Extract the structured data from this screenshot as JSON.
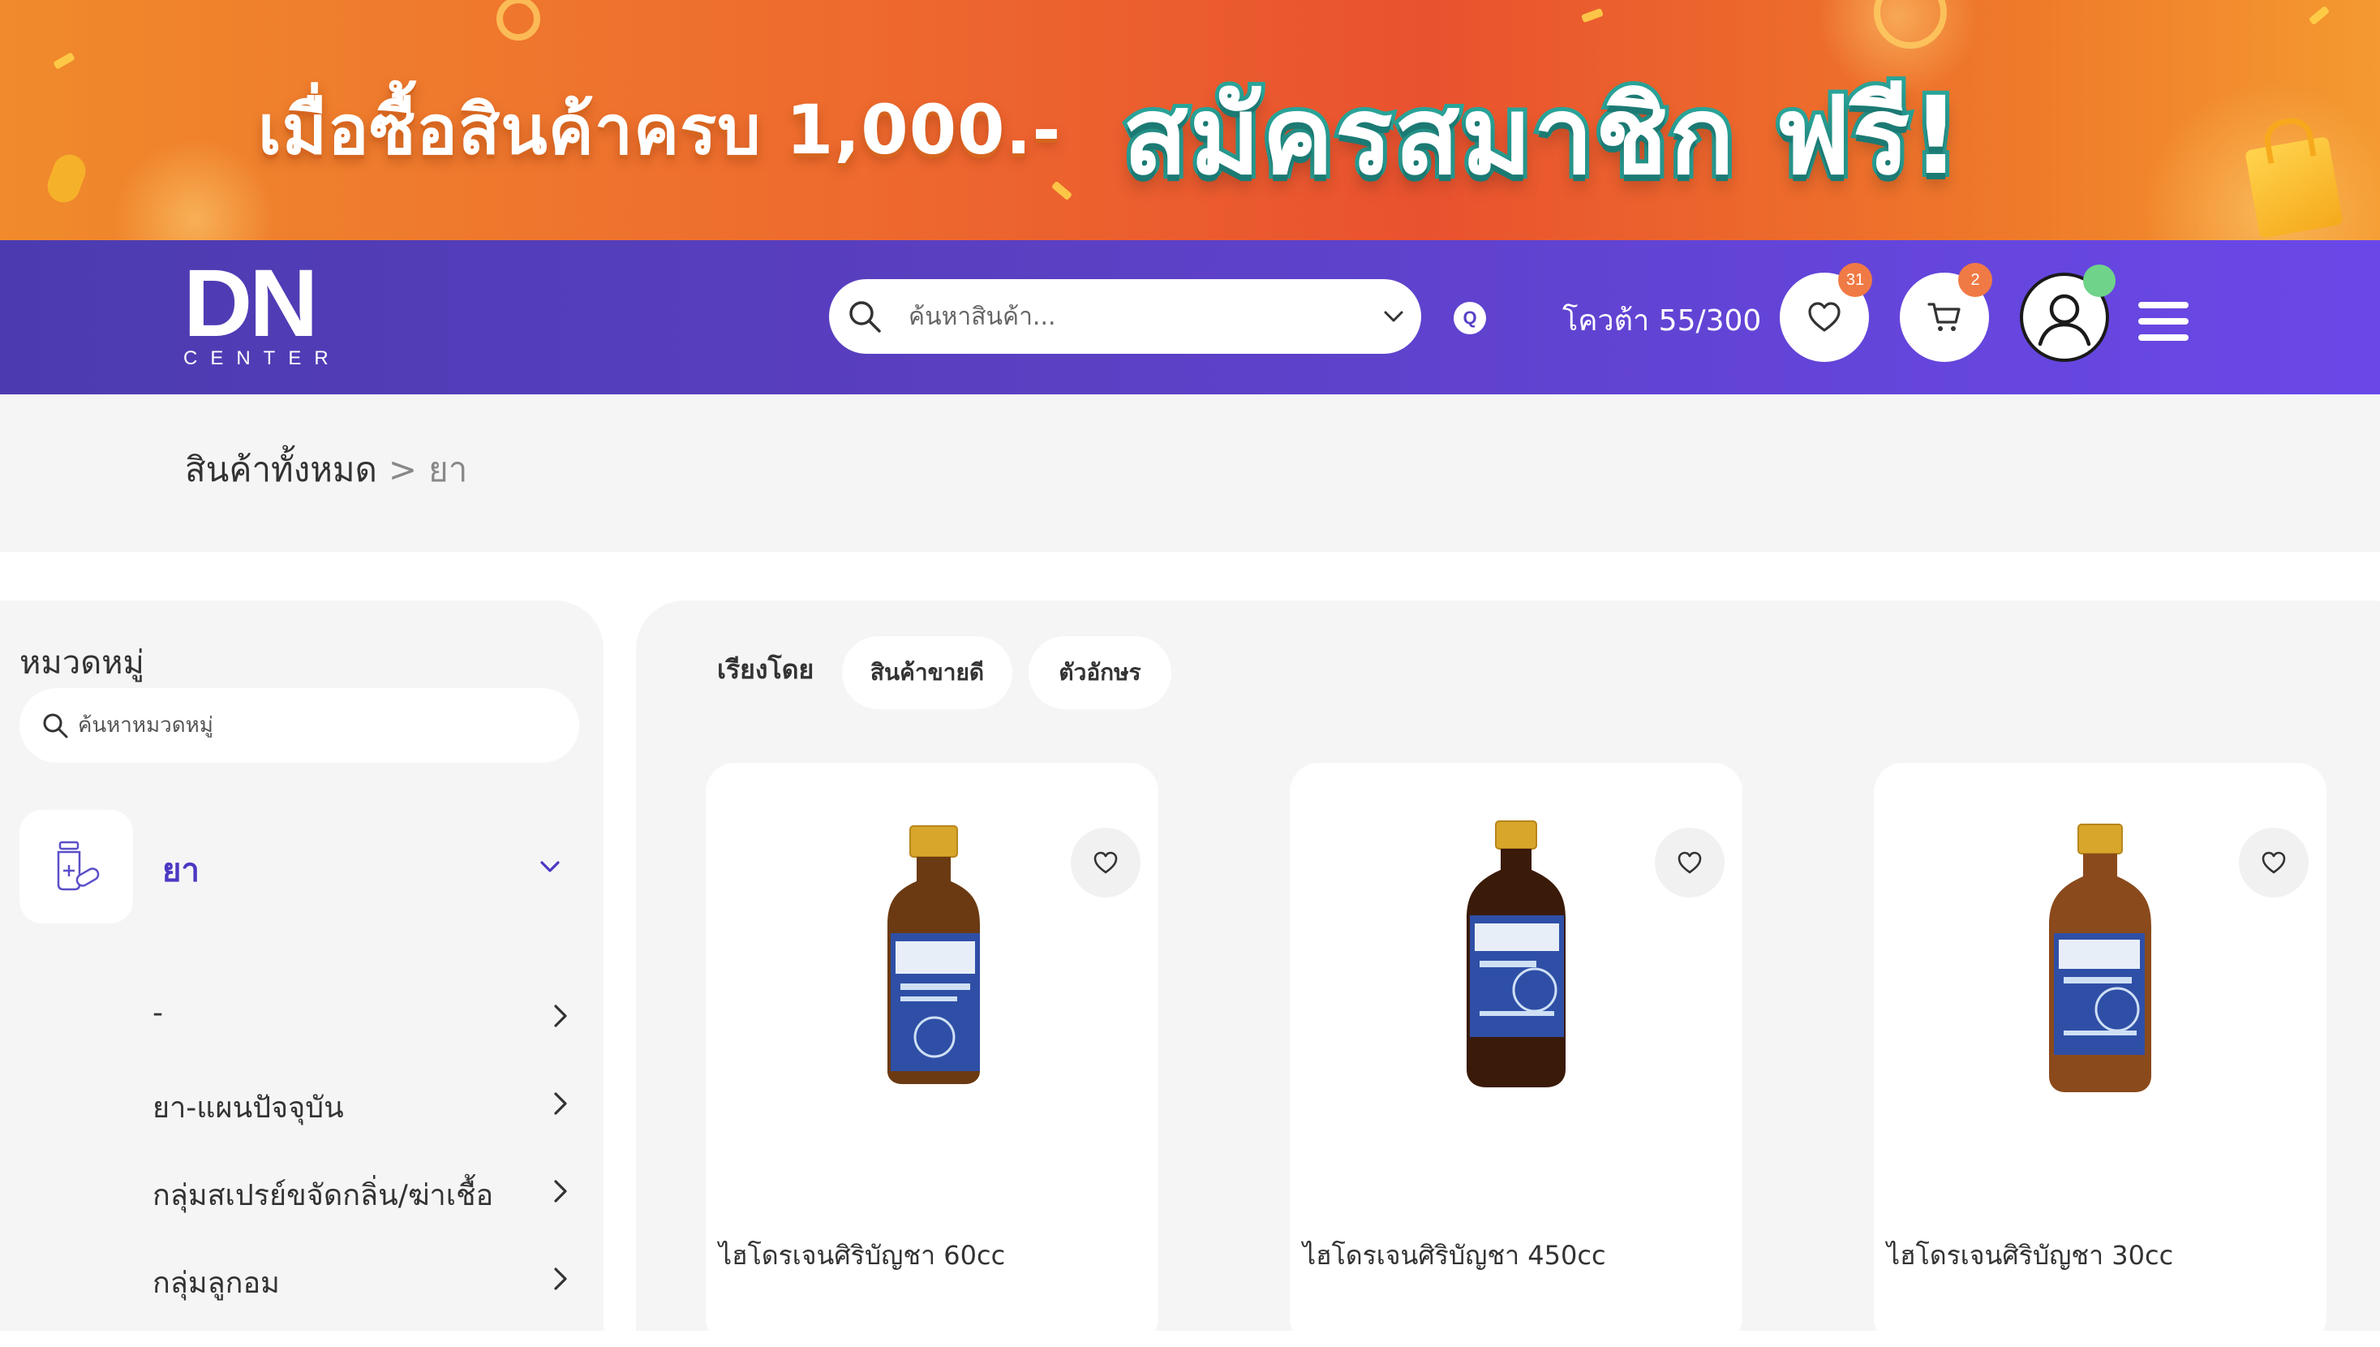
{
  "banner": {
    "text_left": "เมื่อซื้อสินค้าครบ 1,000.-",
    "text_right": "สมัครสมาชิก ฟรี!"
  },
  "header": {
    "logo_main": "DN",
    "logo_sub": "CENTER",
    "search_placeholder": "ค้นหาสินค้า...",
    "q_badge": "Q",
    "quota": "โควต้า 55/300",
    "wishlist_count": "31",
    "cart_count": "2",
    "colors": {
      "header_start": "#4c3bb0",
      "header_end": "#6a48e8",
      "badge": "#f07a45",
      "online": "#6fd38a"
    }
  },
  "breadcrumb": {
    "root": "สินค้าทั้งหมด",
    "separator": ">",
    "current": "ยา"
  },
  "sidebar": {
    "title": "หมวดหมู่",
    "search_placeholder": "ค้นหาหมวดหมู่",
    "main_category": "ยา",
    "sub_items": [
      {
        "label": "-"
      },
      {
        "label": "ยา-แผนปัจจุบัน"
      },
      {
        "label": "กลุ่มสเปรย์ขจัดกลิ่น/ฆ่าเชื้อ"
      },
      {
        "label": "กลุ่มลูกอม"
      }
    ]
  },
  "products": {
    "sort_label": "เรียงโดย",
    "sort_options": [
      "สินค้าขายดี",
      "ตัวอักษร"
    ],
    "items": [
      {
        "name": "ไฮโดรเจนศิริบัญชา 60cc",
        "bottle_color": "#6b3a12"
      },
      {
        "name": "ไฮโดรเจนศิริบัญชา 450cc",
        "bottle_color": "#3a1a08"
      },
      {
        "name": "ไฮโดรเจนศิริบัญชา 30cc",
        "bottle_color": "#8a4a1c"
      }
    ]
  }
}
